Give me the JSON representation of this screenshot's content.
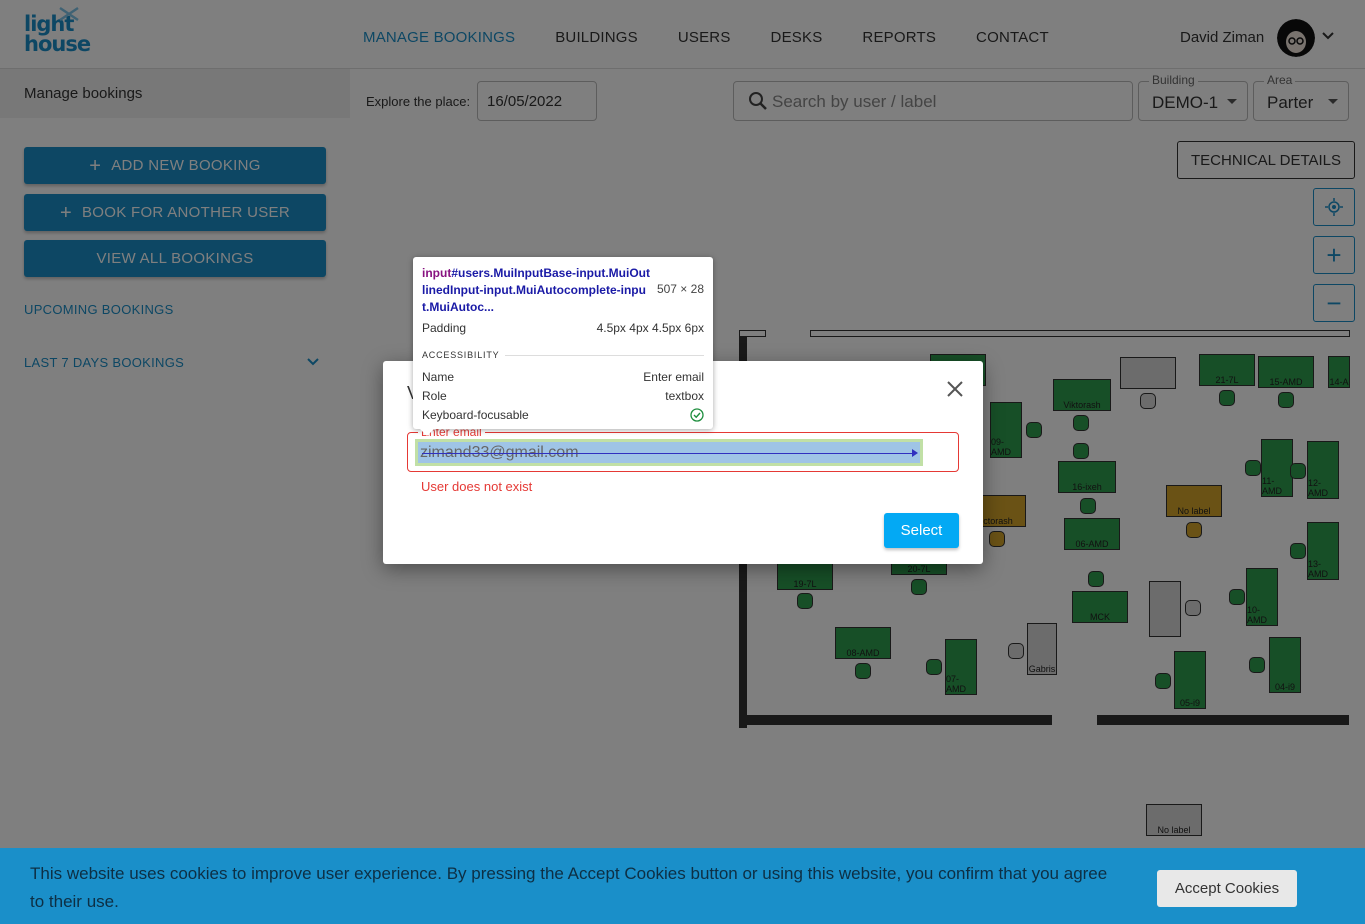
{
  "header": {
    "logo_line1": "light",
    "logo_line2": "house",
    "nav": [
      "MANAGE BOOKINGS",
      "BUILDINGS",
      "USERS",
      "DESKS",
      "REPORTS",
      "CONTACT"
    ],
    "user_name": "David Ziman"
  },
  "sidebar": {
    "title": "Manage bookings",
    "buttons": [
      "ADD NEW BOOKING",
      "BOOK FOR ANOTHER USER",
      "VIEW ALL BOOKINGS"
    ],
    "links": [
      "UPCOMING BOOKINGS",
      "LAST 7 DAYS BOOKINGS"
    ]
  },
  "main": {
    "explore_label": "Explore the place:",
    "date_value": "16/05/2022",
    "search_placeholder": "Search by user / label",
    "building_label": "Building",
    "building_value": "DEMO-1",
    "area_label": "Area",
    "area_value": "Parter",
    "tech_details": "TECHNICAL DETAILS"
  },
  "floor_labels": [
    "Viktorash",
    "21-7L",
    "15-AMD",
    "14-A",
    "09-AMD",
    "16-ixeh",
    "11-AMD",
    "12-AMD",
    "ctorash",
    "No label",
    "06-AMD",
    "19-7L",
    "20-7L",
    "13-AMD",
    "10-AMD",
    "MCK",
    "08-AMD",
    "07-AMD",
    "Gabris",
    "05-i9",
    "04-i9",
    "No label"
  ],
  "dialog": {
    "title": "V",
    "email_label": "Enter email",
    "email_value": "zimand33@gmail.com",
    "error": "User does not exist",
    "select": "Select"
  },
  "devtools": {
    "selector_tag": "input",
    "selector_rest": "#users.MuiInputBase-input.MuiOutlinedInput-input.MuiAutocomplete-input.MuiAutoc...",
    "dims": "507 × 28",
    "padding_label": "Padding",
    "padding_value": "4.5px 4px 4.5px 6px",
    "section": "ACCESSIBILITY",
    "name_label": "Name",
    "name_value": "Enter email",
    "role_label": "Role",
    "role_value": "textbox",
    "kb_label": "Keyboard-focusable"
  },
  "cookie": {
    "text": "This website uses cookies to improve user experience. By pressing the Accept Cookies button or using this website, you confirm that you agree to their use.",
    "button": "Accept Cookies"
  },
  "colors": {
    "brand": "#1a8fc9",
    "error": "#e53935",
    "desk_green": "#2e9e4f",
    "desk_yellow": "#d4a52a"
  }
}
